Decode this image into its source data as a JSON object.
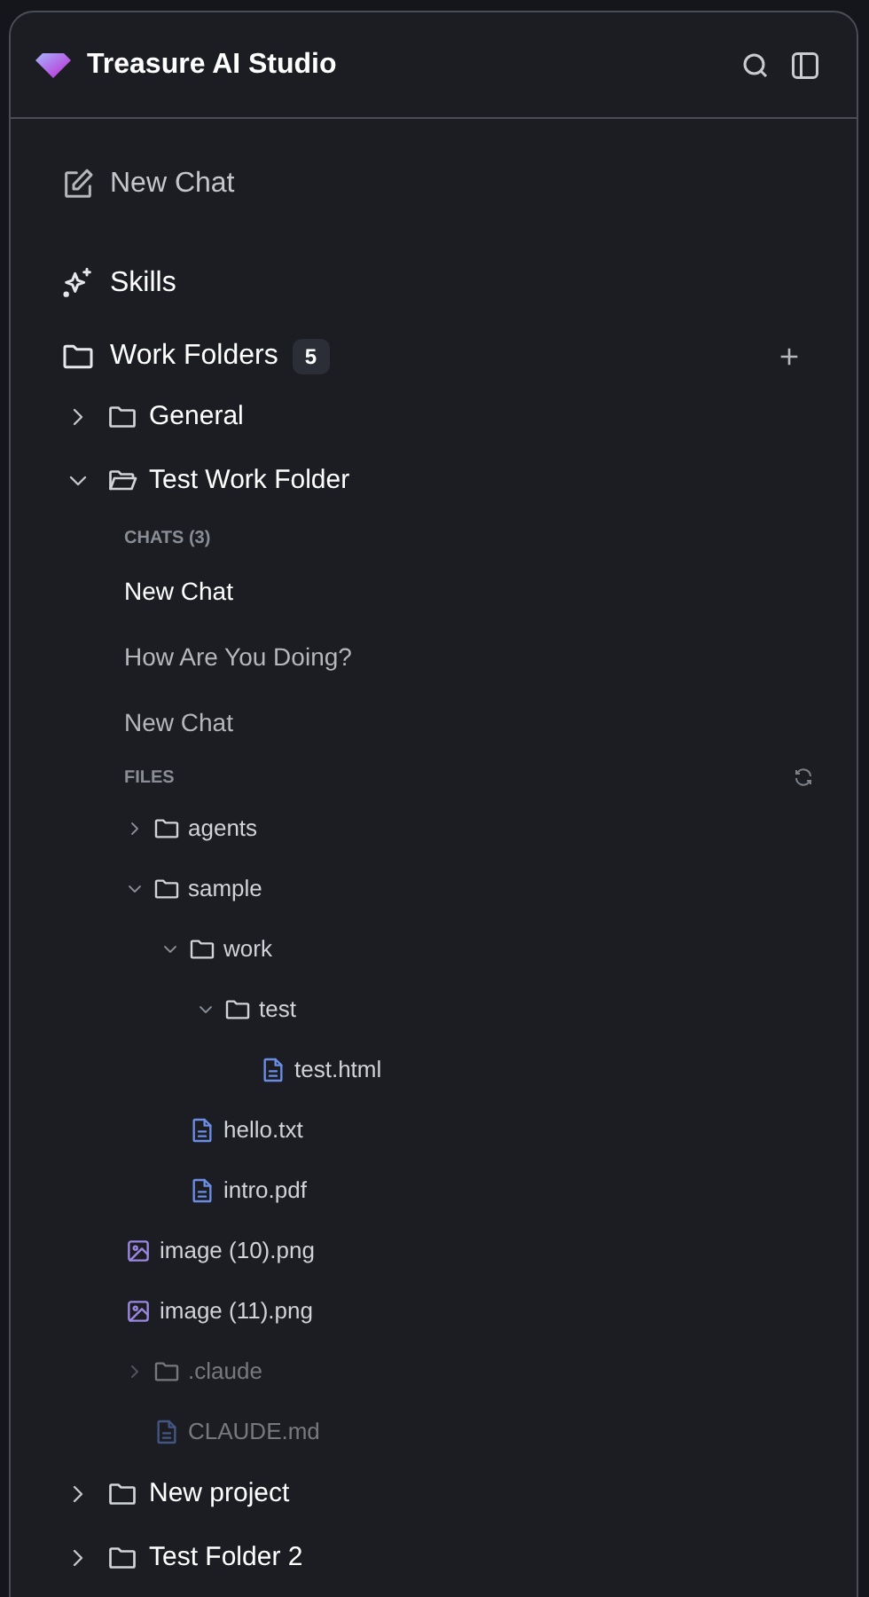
{
  "app": {
    "title": "Treasure AI Studio"
  },
  "new_chat": {
    "label": "New Chat"
  },
  "skills": {
    "label": "Skills"
  },
  "work_folders": {
    "label": "Work Folders",
    "count": "5",
    "folders": [
      {
        "name": "General",
        "expanded": false
      },
      {
        "name": "Test Work Folder",
        "expanded": true,
        "chats_label": "CHATS (3)",
        "chats": [
          {
            "title": "New Chat",
            "selected": true
          },
          {
            "title": "How Are You Doing?",
            "selected": false
          },
          {
            "title": "New Chat",
            "selected": false
          }
        ],
        "files_label": "FILES",
        "files": [
          {
            "kind": "folder",
            "name": "agents",
            "expanded": false,
            "dimmed": false
          },
          {
            "kind": "folder",
            "name": "sample",
            "expanded": true,
            "dimmed": false,
            "children": [
              {
                "kind": "folder",
                "name": "work",
                "expanded": true,
                "dimmed": false,
                "children": [
                  {
                    "kind": "folder",
                    "name": "test",
                    "expanded": true,
                    "dimmed": false,
                    "children": [
                      {
                        "kind": "file",
                        "name": "test.html",
                        "dimmed": false
                      }
                    ]
                  }
                ]
              },
              {
                "kind": "file",
                "name": "hello.txt",
                "dimmed": false
              },
              {
                "kind": "file",
                "name": "intro.pdf",
                "dimmed": false
              }
            ]
          },
          {
            "kind": "image",
            "name": "image (10).png",
            "dimmed": false
          },
          {
            "kind": "image",
            "name": "image (11).png",
            "dimmed": false
          },
          {
            "kind": "folder",
            "name": ".claude",
            "expanded": false,
            "dimmed": true
          },
          {
            "kind": "file",
            "name": "CLAUDE.md",
            "dimmed": true
          }
        ]
      },
      {
        "name": "New project",
        "expanded": false
      },
      {
        "name": "Test Folder 2",
        "expanded": false
      }
    ]
  }
}
